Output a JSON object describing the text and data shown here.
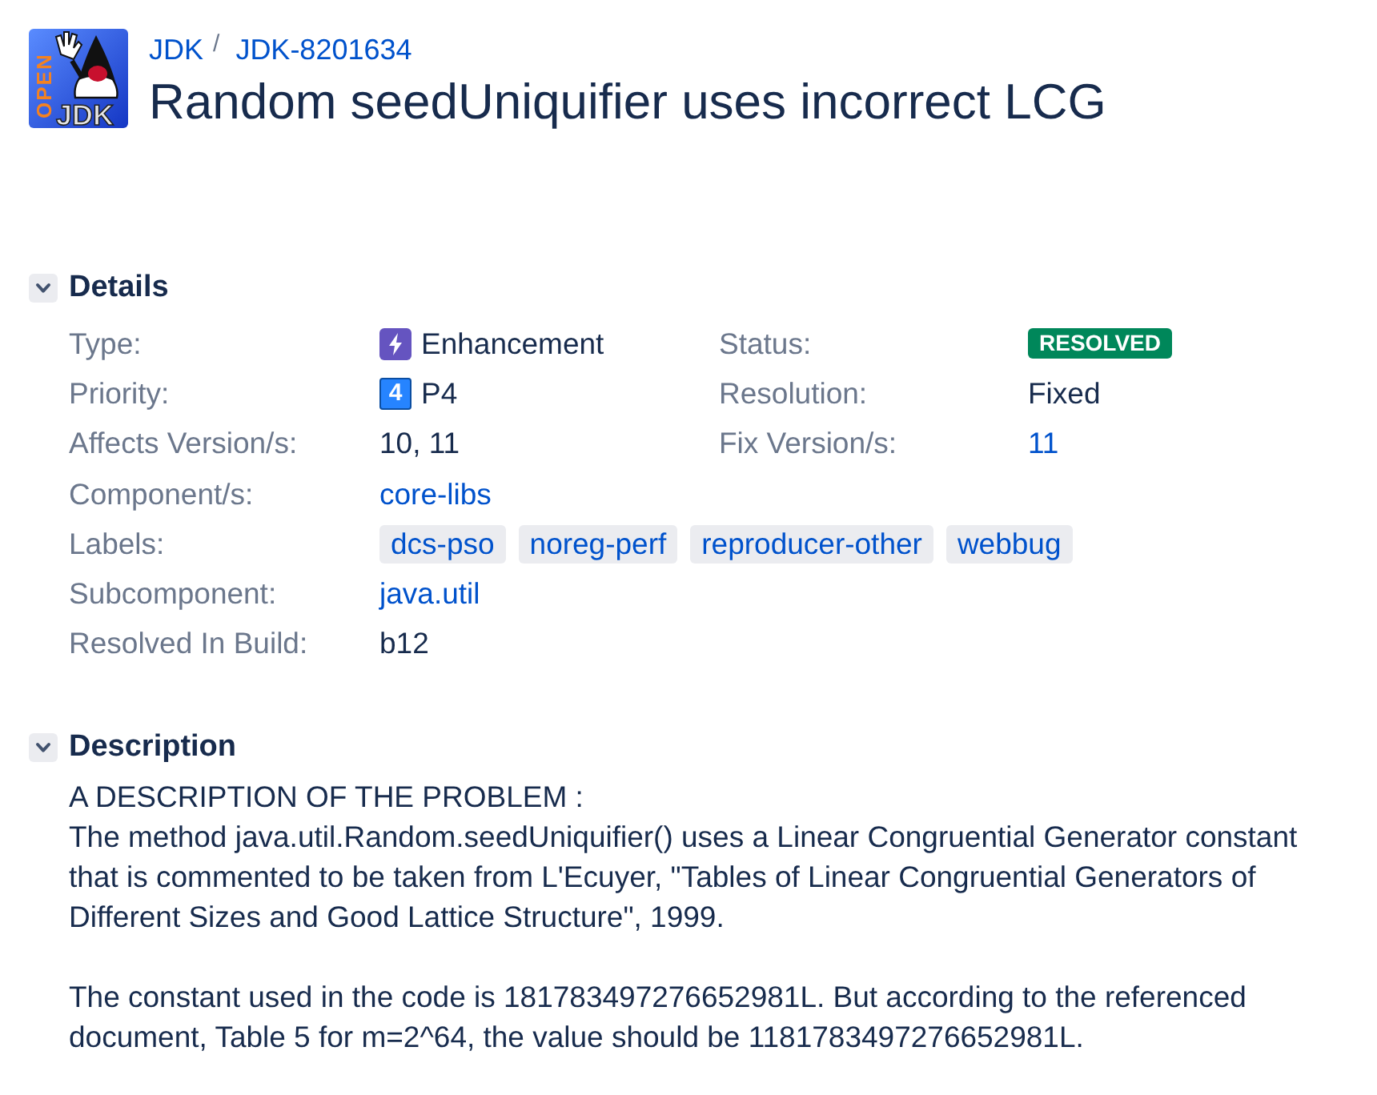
{
  "logo": {
    "side_text": "OPEN",
    "bottom_text": "JDK"
  },
  "breadcrumbs": {
    "items": [
      "JDK",
      "JDK-8201634"
    ],
    "separator": "/"
  },
  "title": "Random seedUniquifier uses incorrect LCG",
  "details": {
    "heading": "Details",
    "expanded": true,
    "left": [
      {
        "label": "Type:",
        "kind": "issue-type",
        "value": "Enhancement"
      },
      {
        "label": "Priority:",
        "kind": "priority",
        "icon_text": "4",
        "value": "P4"
      },
      {
        "label": "Affects Version/s:",
        "kind": "text",
        "value": "10, 11"
      },
      {
        "label": "Component/s:",
        "kind": "link",
        "value": "core-libs"
      },
      {
        "label": "Labels:",
        "kind": "tags",
        "values": [
          "dcs-pso",
          "noreg-perf",
          "reproducer-other",
          "webbug"
        ]
      },
      {
        "label": "Subcomponent:",
        "kind": "link",
        "value": "java.util"
      },
      {
        "label": "Resolved In Build:",
        "kind": "text",
        "value": "b12"
      }
    ],
    "right": [
      {
        "label": "Status:",
        "kind": "status",
        "value": "RESOLVED"
      },
      {
        "label": "Resolution:",
        "kind": "text",
        "value": "Fixed"
      },
      {
        "label": "Fix Version/s:",
        "kind": "link",
        "value": "11"
      }
    ]
  },
  "description": {
    "heading": "Description",
    "expanded": true,
    "paragraphs": [
      {
        "lines": [
          "A DESCRIPTION OF THE PROBLEM :",
          "The method java.util.Random.seedUniquifier() uses a Linear Congruential Generator constant that is commented to be taken from L'Ecuyer, \"Tables of Linear Congruential Generators of Different Sizes and Good Lattice Structure\", 1999."
        ]
      },
      {
        "lines": [
          "The constant used in the code is 181783497276652981L. But according to the referenced document, Table 5 for m=2^64, the value should be 1181783497276652981L."
        ]
      }
    ]
  }
}
